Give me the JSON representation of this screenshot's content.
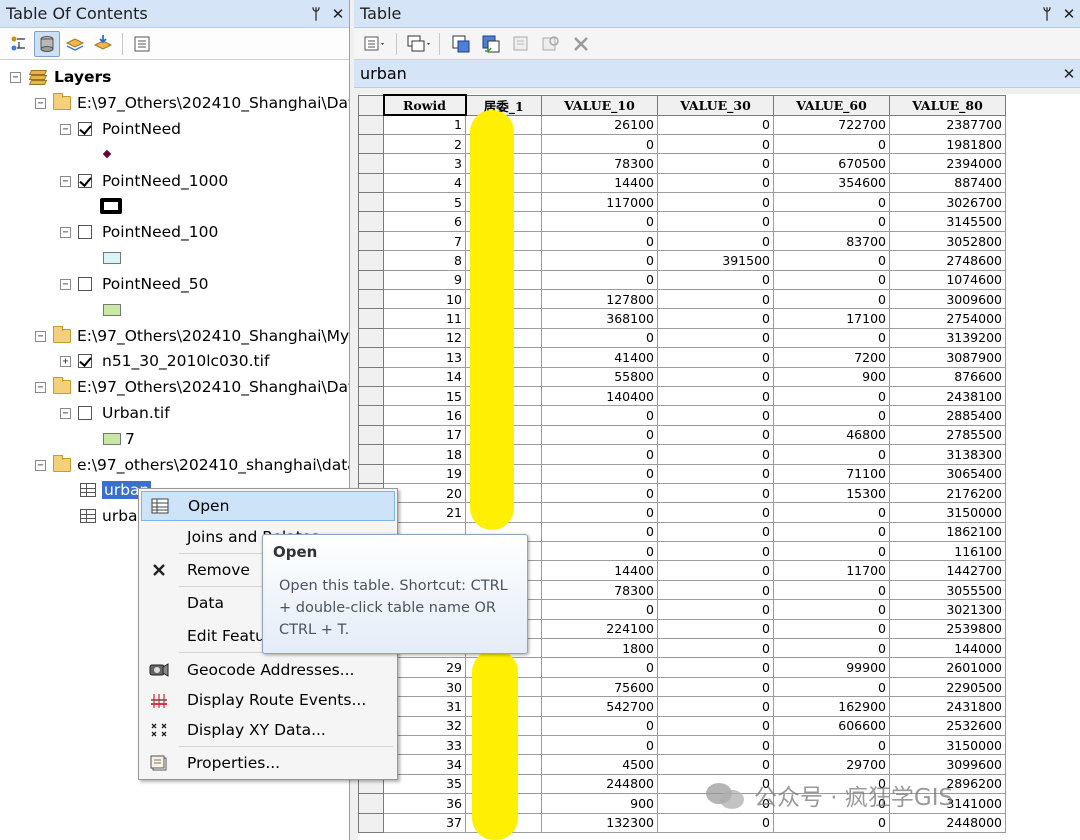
{
  "toc": {
    "title": "Table Of Contents",
    "pin_glyph": "ᛘ",
    "close_glyph": "✕",
    "layers_label": "Layers",
    "items": [
      {
        "kind": "group",
        "label": "E:\\97_Others\\202410_Shanghai\\Dat"
      },
      {
        "kind": "layer",
        "label": "PointNeed",
        "checked": true
      },
      {
        "kind": "layer",
        "label": "PointNeed_1000",
        "checked": true
      },
      {
        "kind": "layer",
        "label": "PointNeed_100",
        "checked": false
      },
      {
        "kind": "layer",
        "label": "PointNeed_50",
        "checked": false
      },
      {
        "kind": "group",
        "label": "E:\\97_Others\\202410_Shanghai\\MyI"
      },
      {
        "kind": "layer",
        "label": "n51_30_2010lc030.tif",
        "checked": true
      },
      {
        "kind": "group",
        "label": "E:\\97_Others\\202410_Shanghai\\Dat"
      },
      {
        "kind": "layer",
        "label": "Urban.tif",
        "checked": false
      },
      {
        "kind": "legend",
        "label": "7"
      },
      {
        "kind": "group",
        "label": "e:\\97_others\\202410_shanghai\\data"
      },
      {
        "kind": "table",
        "label": "urban",
        "selected": true
      },
      {
        "kind": "table",
        "label": "urba"
      }
    ],
    "colors": {
      "swatch_green": "#c6e9a4",
      "swatch_cyan": "#d8f4f6",
      "point": "#6a0033"
    }
  },
  "table_pane": {
    "title": "Table",
    "tab_label": "urban",
    "pin_glyph": "ᛘ",
    "close_glyph": "✕",
    "columns": [
      "Rowid",
      "居委_1",
      "VALUE_10",
      "VALUE_30",
      "VALUE_60",
      "VALUE_80"
    ],
    "rows": [
      [
        "1",
        "",
        "26100",
        "0",
        "722700",
        "2387700"
      ],
      [
        "2",
        "",
        "0",
        "0",
        "0",
        "1981800"
      ],
      [
        "3",
        "",
        "78300",
        "0",
        "670500",
        "2394000"
      ],
      [
        "4",
        "",
        "14400",
        "0",
        "354600",
        "887400"
      ],
      [
        "5",
        "",
        "117000",
        "0",
        "0",
        "3026700"
      ],
      [
        "6",
        "",
        "0",
        "0",
        "0",
        "3145500"
      ],
      [
        "7",
        "",
        "0",
        "0",
        "83700",
        "3052800"
      ],
      [
        "8",
        "",
        "0",
        "391500",
        "0",
        "2748600"
      ],
      [
        "9",
        "",
        "0",
        "0",
        "0",
        "1074600"
      ],
      [
        "10",
        "",
        "127800",
        "0",
        "0",
        "3009600"
      ],
      [
        "11",
        "",
        "368100",
        "0",
        "17100",
        "2754000"
      ],
      [
        "12",
        "",
        "0",
        "0",
        "0",
        "3139200"
      ],
      [
        "13",
        "",
        "41400",
        "0",
        "7200",
        "3087900"
      ],
      [
        "14",
        "",
        "55800",
        "0",
        "900",
        "876600"
      ],
      [
        "15",
        "",
        "140400",
        "0",
        "0",
        "2438100"
      ],
      [
        "16",
        "",
        "0",
        "0",
        "0",
        "2885400"
      ],
      [
        "17",
        "",
        "0",
        "0",
        "46800",
        "2785500"
      ],
      [
        "18",
        "",
        "0",
        "0",
        "0",
        "3138300"
      ],
      [
        "19",
        "",
        "0",
        "0",
        "71100",
        "3065400"
      ],
      [
        "20",
        "",
        "0",
        "0",
        "15300",
        "2176200"
      ],
      [
        "21",
        "",
        "0",
        "0",
        "0",
        "3150000"
      ],
      [
        "",
        "",
        "0",
        "0",
        "0",
        "1862100"
      ],
      [
        "",
        "",
        "0",
        "0",
        "0",
        "116100"
      ],
      [
        "",
        "",
        "14400",
        "0",
        "11700",
        "1442700"
      ],
      [
        "",
        "",
        "78300",
        "0",
        "0",
        "3055500"
      ],
      [
        "",
        "",
        "0",
        "0",
        "0",
        "3021300"
      ],
      [
        "",
        "",
        "224100",
        "0",
        "0",
        "2539800"
      ],
      [
        "",
        "",
        "1800",
        "0",
        "0",
        "144000"
      ],
      [
        "29",
        "",
        "0",
        "0",
        "99900",
        "2601000"
      ],
      [
        "30",
        "",
        "75600",
        "0",
        "0",
        "2290500"
      ],
      [
        "31",
        "",
        "542700",
        "0",
        "162900",
        "2431800"
      ],
      [
        "32",
        "",
        "0",
        "0",
        "606600",
        "2532600"
      ],
      [
        "33",
        "",
        "0",
        "0",
        "0",
        "3150000"
      ],
      [
        "34",
        "",
        "4500",
        "0",
        "29700",
        "3099600"
      ],
      [
        "35",
        "",
        "244800",
        "0",
        "0",
        "2896200"
      ],
      [
        "36",
        "",
        "900",
        "0",
        "0",
        "3141000"
      ],
      [
        "37",
        "",
        "132300",
        "0",
        "0",
        "2448000"
      ]
    ],
    "highlight_color": "#ffef00"
  },
  "context_menu": {
    "items": [
      {
        "label": "Open",
        "icon": "table-icon",
        "hot": true
      },
      {
        "label": "Joins and Relates",
        "icon": "",
        "submenu": true
      },
      {
        "label": "Remove",
        "icon": "close-icon"
      },
      {
        "label": "Data",
        "icon": ""
      },
      {
        "label": "Edit Features",
        "icon": ""
      },
      {
        "label": "Geocode Addresses...",
        "icon": "geocode-icon"
      },
      {
        "label": "Display Route Events...",
        "icon": "route-events-icon"
      },
      {
        "label": "Display XY Data...",
        "icon": "xy-data-icon"
      },
      {
        "label": "Properties...",
        "icon": "properties-icon"
      }
    ]
  },
  "tooltip": {
    "title": "Open",
    "body": "Open this table. Shortcut: CTRL + double-click table name OR CTRL + T."
  },
  "watermark": {
    "text": "公众号 · 疯狂学GIS"
  }
}
